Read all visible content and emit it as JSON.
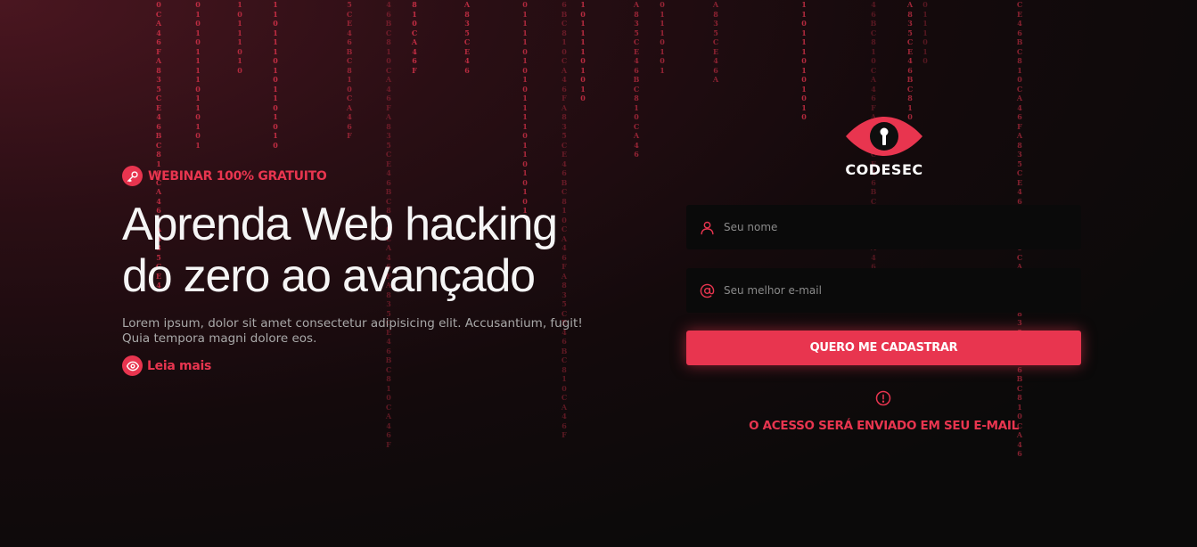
{
  "theme": {
    "accent": "#e8354f",
    "background": "#0b0a0a"
  },
  "background": {
    "digit_rain": [
      "0CA46FA835CE46BC810CA46FA835CE4",
      "0101011110110101",
      "10111010",
      "1101110101101010",
      "5CE46BC810CA46F",
      "46BC810CA46FA835CE46BC810CA46FA835CE46BC810CA46F",
      "810CA46F",
      "A835CE46",
      "01111010101111011010101",
      "6BC810CA46FA835CE46BC810CA46FA835CE46BC810CA46F",
      "10111101010",
      "A835CE46BC810CA46",
      "01110101",
      "A835CE46A",
      "1101110101010",
      "46BC810CA46FA835CE46BC810CA46F",
      "A835CE46BC810",
      "0111010",
      "CE46BC810CA46FA835CE46BC810CA46FA835CE46BC810CA46"
    ]
  },
  "hero": {
    "badge_icon": "key-icon",
    "badge": "WEBINAR 100% GRATUITO",
    "title_line1": "Aprenda Web hacking",
    "title_line2": "do zero ao avançado",
    "description": "Lorem ipsum, dolor sit amet consectetur adipisicing elit. Accusantium, fugit! Quia tempora magni dolore eos.",
    "read_more_icon": "eye-icon",
    "read_more": "Leia mais"
  },
  "brand": {
    "logo_icon": "eye-keyhole-icon",
    "name": "CODESEC"
  },
  "form": {
    "name_icon": "user-icon",
    "name_placeholder": "Seu nome",
    "email_icon": "at-sign-icon",
    "email_placeholder": "Seu melhor e-mail",
    "submit_label": "QUERO ME CADASTRAR",
    "notice_icon": "alert-circle-icon",
    "notice": "O ACESSO SERÁ ENVIADO EM SEU E-MAIL"
  }
}
